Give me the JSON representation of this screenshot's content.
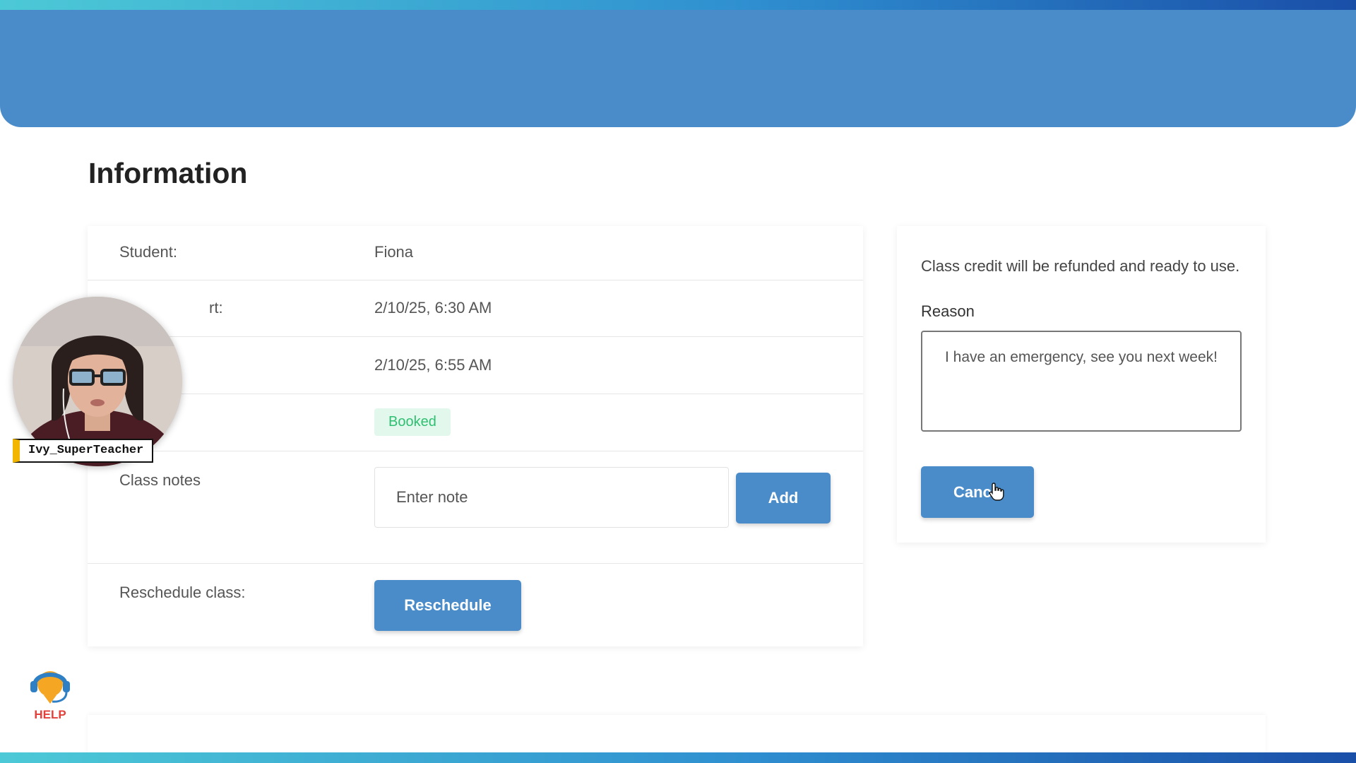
{
  "page": {
    "title": "Information"
  },
  "info": {
    "student": {
      "label": "Student:",
      "value": "Fiona"
    },
    "start": {
      "label": "rt:",
      "value": "2/10/25, 6:30 AM"
    },
    "end": {
      "value": "2/10/25, 6:55 AM"
    },
    "status": {
      "value": "Booked"
    },
    "notes": {
      "label": "Class notes",
      "placeholder": "Enter note",
      "add_label": "Add"
    },
    "reschedule": {
      "label": "Reschedule class:",
      "button_label": "Reschedule"
    }
  },
  "cancel_panel": {
    "refund_text": "Class credit will be refunded and ready to use.",
    "reason_label": "Reason",
    "reason_value": "I have an emergency, see you next week!",
    "cancel_label": "Canc"
  },
  "overlay": {
    "presenter_name": "Ivy_SuperTeacher",
    "help_label": "HELP"
  },
  "colors": {
    "primary": "#4a8cca",
    "status_booked_bg": "#e3f8ed",
    "status_booked_text": "#2fbf71",
    "help_orange": "#f5a623",
    "help_red": "#e2403a"
  }
}
